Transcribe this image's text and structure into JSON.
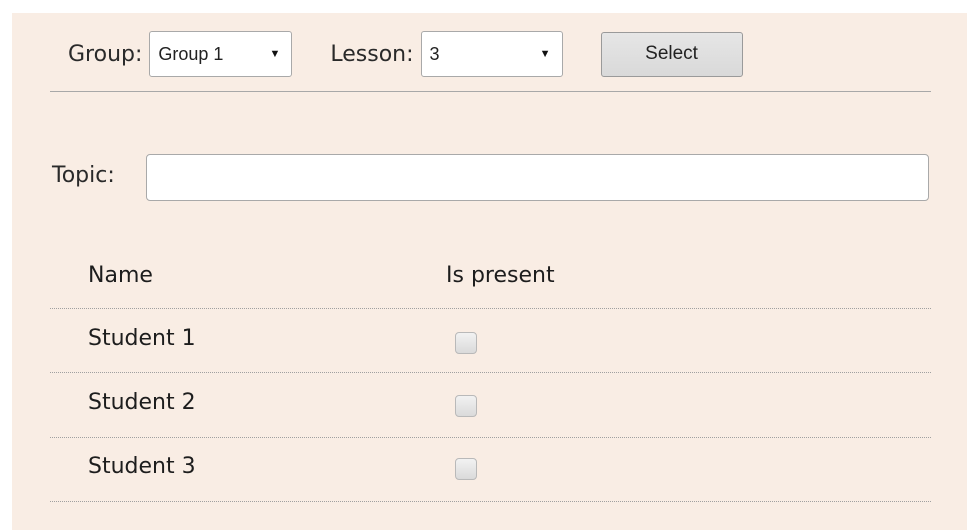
{
  "filters": {
    "group_label": "Group:",
    "group_value": "Group 1",
    "lesson_label": "Lesson:",
    "lesson_value": "3",
    "select_button": "Select"
  },
  "topic": {
    "label": "Topic:",
    "value": ""
  },
  "table": {
    "headers": [
      "Name",
      "Is present"
    ],
    "rows": [
      {
        "name": "Student 1",
        "present": false
      },
      {
        "name": "Student 2",
        "present": false
      },
      {
        "name": "Student 3",
        "present": false
      }
    ]
  },
  "icons": {
    "dropdown_caret": "chevron-down-icon"
  }
}
